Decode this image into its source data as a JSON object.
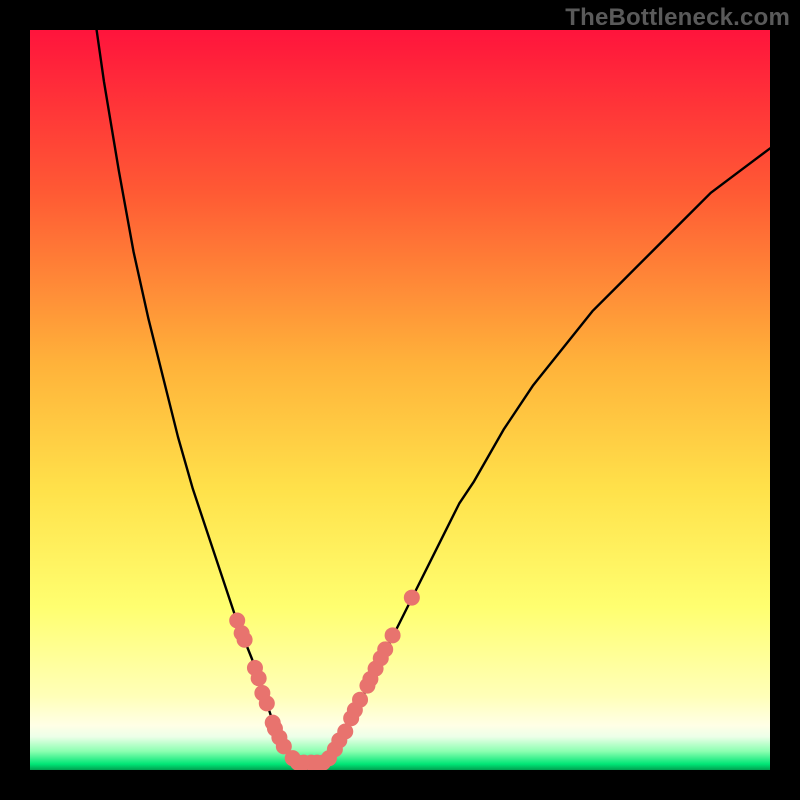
{
  "watermark": {
    "text": "TheBottleneck.com"
  },
  "colors": {
    "page_bg": "#000000",
    "gradient_top": "#ff143c",
    "gradient_mid1": "#ff7a2a",
    "gradient_mid2": "#ffd93c",
    "gradient_low": "#ffff6a",
    "gradient_pale": "#ffffc0",
    "gradient_near_bottom": "#d8ffe0",
    "gradient_band": "#00e676",
    "gradient_bottom_line": "#00a050",
    "curve": "#000000",
    "dot_fill": "#e8736e",
    "dot_stroke": "#c94f49"
  },
  "chart_data": {
    "type": "line",
    "title": "",
    "xlabel": "",
    "ylabel": "",
    "xlim": [
      0,
      100
    ],
    "ylim": [
      0,
      100
    ],
    "curve_left": {
      "x": [
        9,
        10,
        12,
        14,
        16,
        18,
        20,
        22,
        24,
        26,
        28,
        30,
        32,
        33,
        34,
        35,
        36
      ],
      "y": [
        100,
        93,
        81,
        70,
        61,
        53,
        45,
        38,
        32,
        26,
        20,
        15,
        9,
        6,
        4,
        2,
        1
      ]
    },
    "curve_right": {
      "x": [
        40,
        41,
        42,
        43,
        44,
        46,
        48,
        50,
        52,
        54,
        56,
        58,
        60,
        64,
        68,
        72,
        76,
        80,
        84,
        88,
        92,
        96,
        100
      ],
      "y": [
        1,
        2,
        4,
        6,
        8,
        12,
        16,
        20,
        24,
        28,
        32,
        36,
        39,
        46,
        52,
        57,
        62,
        66,
        70,
        74,
        78,
        81,
        84
      ]
    },
    "flat_segment": {
      "x": [
        36,
        40
      ],
      "y": [
        1,
        1
      ]
    },
    "marker_clusters": [
      {
        "side": "left",
        "x": 28.0,
        "y": 20.2
      },
      {
        "side": "left",
        "x": 28.6,
        "y": 18.5
      },
      {
        "side": "left",
        "x": 29.0,
        "y": 17.6
      },
      {
        "side": "left",
        "x": 30.4,
        "y": 13.8
      },
      {
        "side": "left",
        "x": 30.9,
        "y": 12.4
      },
      {
        "side": "left",
        "x": 31.4,
        "y": 10.4
      },
      {
        "side": "left",
        "x": 32.0,
        "y": 9.0
      },
      {
        "side": "left",
        "x": 32.8,
        "y": 6.4
      },
      {
        "side": "left",
        "x": 33.1,
        "y": 5.6
      },
      {
        "side": "left",
        "x": 33.7,
        "y": 4.4
      },
      {
        "side": "left",
        "x": 34.3,
        "y": 3.2
      },
      {
        "side": "left",
        "x": 35.5,
        "y": 1.6
      },
      {
        "side": "flat",
        "x": 36.2,
        "y": 1.0
      },
      {
        "side": "flat",
        "x": 37.0,
        "y": 1.0
      },
      {
        "side": "flat",
        "x": 38.0,
        "y": 1.0
      },
      {
        "side": "flat",
        "x": 38.8,
        "y": 1.0
      },
      {
        "side": "flat",
        "x": 39.6,
        "y": 1.0
      },
      {
        "side": "right",
        "x": 40.4,
        "y": 1.6
      },
      {
        "side": "right",
        "x": 41.2,
        "y": 2.8
      },
      {
        "side": "right",
        "x": 41.8,
        "y": 4.0
      },
      {
        "side": "right",
        "x": 42.6,
        "y": 5.2
      },
      {
        "side": "right",
        "x": 43.4,
        "y": 7.0
      },
      {
        "side": "right",
        "x": 43.9,
        "y": 8.1
      },
      {
        "side": "right",
        "x": 44.6,
        "y": 9.5
      },
      {
        "side": "right",
        "x": 45.6,
        "y": 11.4
      },
      {
        "side": "right",
        "x": 46.0,
        "y": 12.3
      },
      {
        "side": "right",
        "x": 46.7,
        "y": 13.7
      },
      {
        "side": "right",
        "x": 47.4,
        "y": 15.1
      },
      {
        "side": "right",
        "x": 48.0,
        "y": 16.3
      },
      {
        "side": "right",
        "x": 49.0,
        "y": 18.2
      },
      {
        "side": "right",
        "x": 51.6,
        "y": 23.3
      }
    ]
  }
}
